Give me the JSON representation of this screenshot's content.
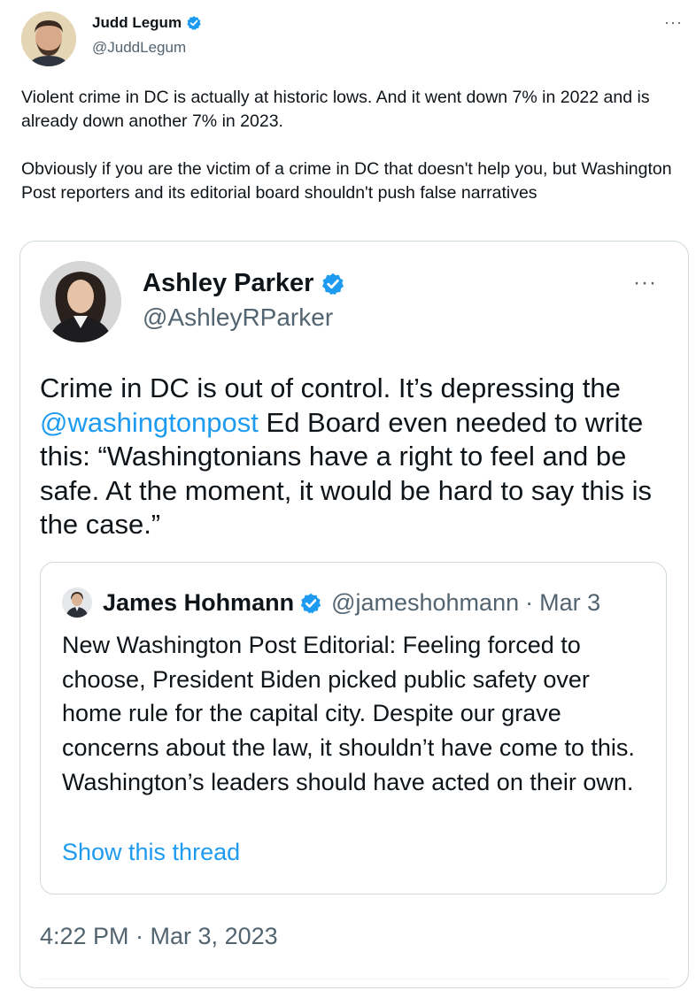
{
  "tweet": {
    "author": {
      "name": "Judd Legum",
      "handle": "@JuddLegum"
    },
    "more_label": "···",
    "text": [
      "Violent crime in DC is actually at historic lows. And it went down 7% in 2022 and is already down another 7% in 2023.",
      "Obviously if you are the victim of a crime in DC that doesn't help you, but Washington Post reporters and its editorial board shouldn't push false narratives"
    ]
  },
  "quoted": {
    "author": {
      "name": "Ashley Parker",
      "handle": "@AshleyRParker"
    },
    "more_label": "···",
    "text_before": "Crime in DC is out of control. It’s depressing the ",
    "mention": "@washingtonpost",
    "text_after": " Ed Board even needed to write this: “Washingtonians have a right to feel and be safe. At the moment, it would be hard to say this is the case.”",
    "timestamp": "4:22 PM · Mar 3, 2023",
    "inner": {
      "author_name": "James Hohmann",
      "author_handle": "@jameshohmann",
      "separator": "·",
      "date": "Mar 3",
      "text": "New Washington Post Editorial: Feeling forced to choose, President Biden picked public safety over home rule for the capital city. Despite our grave concerns about the law, it shouldn’t have come to this. Washington’s leaders should have acted on their own.",
      "link_label": "Show this thread"
    }
  },
  "colors": {
    "verified": "#1d9bf0",
    "link": "#1d9bf0",
    "muted": "#536471",
    "border": "#cfd9de"
  },
  "icons": [
    "verified-badge-icon",
    "more-options-icon"
  ]
}
